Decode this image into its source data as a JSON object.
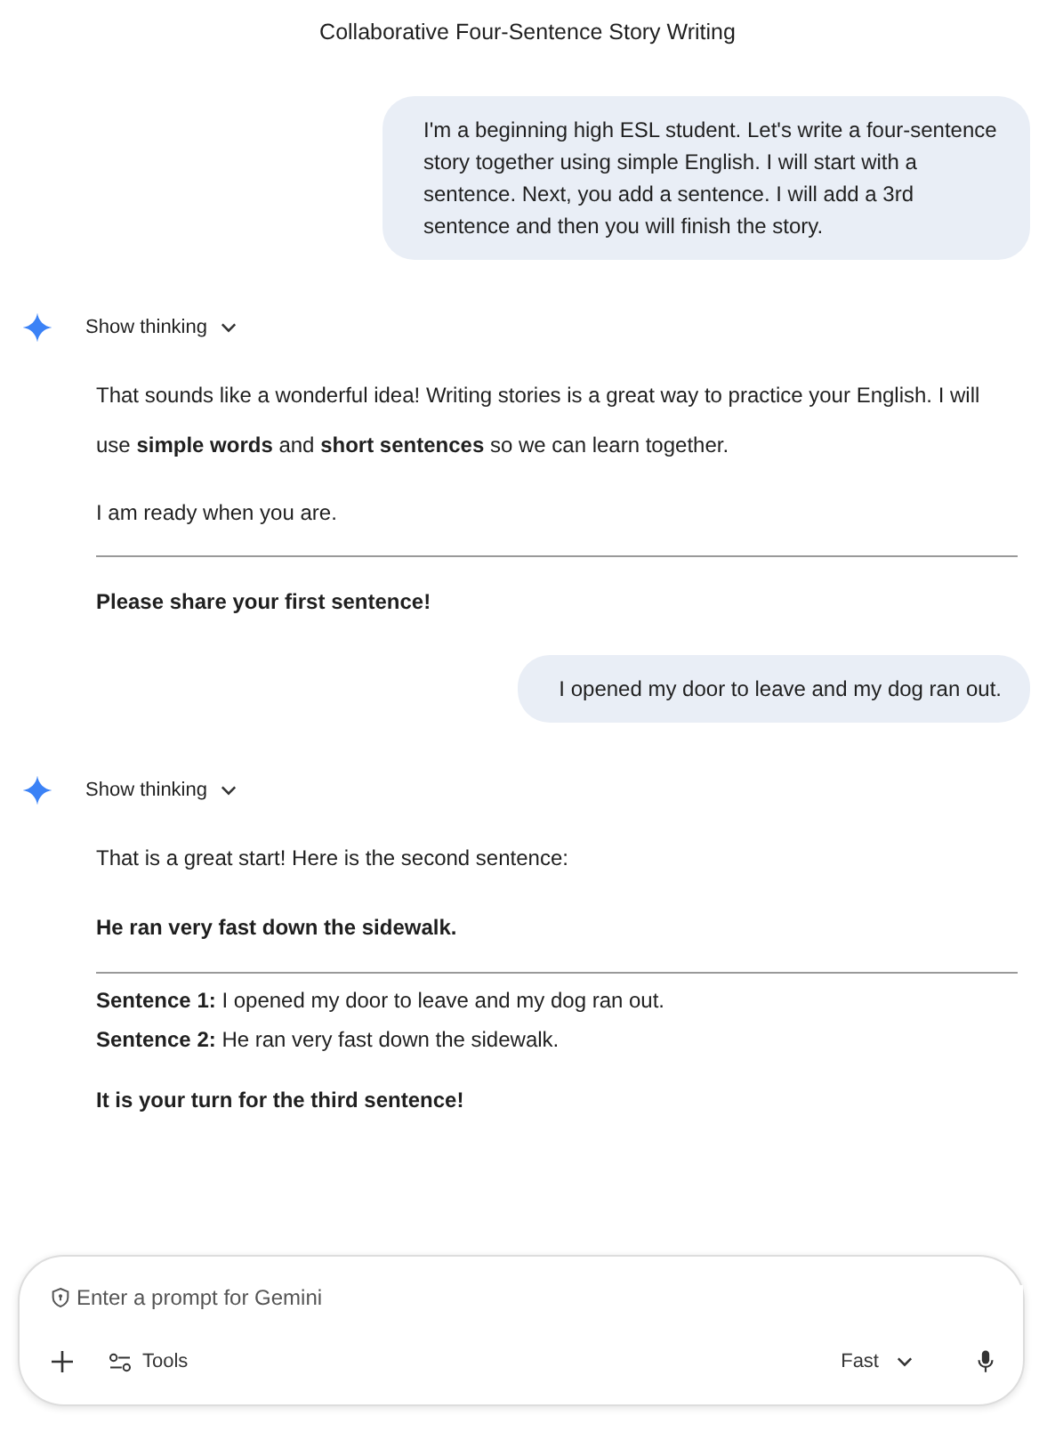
{
  "title": "Collaborative Four-Sentence Story Writing",
  "messages": [
    {
      "kind": "user",
      "text": "I'm a beginning high ESL student. Let's write a four-sentence story together using simple English. I will start with a sentence. Next, you add a sentence. I will add a 3rd sentence and then you will finish the story."
    },
    {
      "kind": "model",
      "thinking_label": "Show thinking",
      "expanded": false,
      "blocks": [
        {
          "kind": "text",
          "text": "That sounds like a wonderful idea! Writing stories is a great way to practice your English. I will use **simple words** and **short sentences** so we can learn together."
        },
        {
          "kind": "text",
          "text": "I am ready when you are."
        },
        {
          "kind": "rule"
        },
        {
          "kind": "strong",
          "text": "Please share your first sentence!"
        }
      ]
    },
    {
      "kind": "user",
      "text": "I opened my door to leave and my dog ran out."
    },
    {
      "kind": "model",
      "thinking_label": "Show thinking",
      "expanded": false,
      "blocks": [
        {
          "kind": "text",
          "text": "That is a great start! Here is the second sentence:"
        },
        {
          "kind": "strong",
          "text": "He ran very fast down the sidewalk."
        },
        {
          "kind": "rule"
        },
        {
          "kind": "tight",
          "text": "**Sentence 1:** I opened my door to leave and my dog ran out."
        },
        {
          "kind": "tight",
          "text": "**Sentence 2:** He ran very fast down the sidewalk."
        },
        {
          "kind": "strong",
          "text": "It is your turn for the third sentence!"
        }
      ]
    }
  ],
  "composer": {
    "placeholder": "Enter a prompt for Gemini",
    "tools_label": "Tools",
    "mode": "Fast"
  }
}
